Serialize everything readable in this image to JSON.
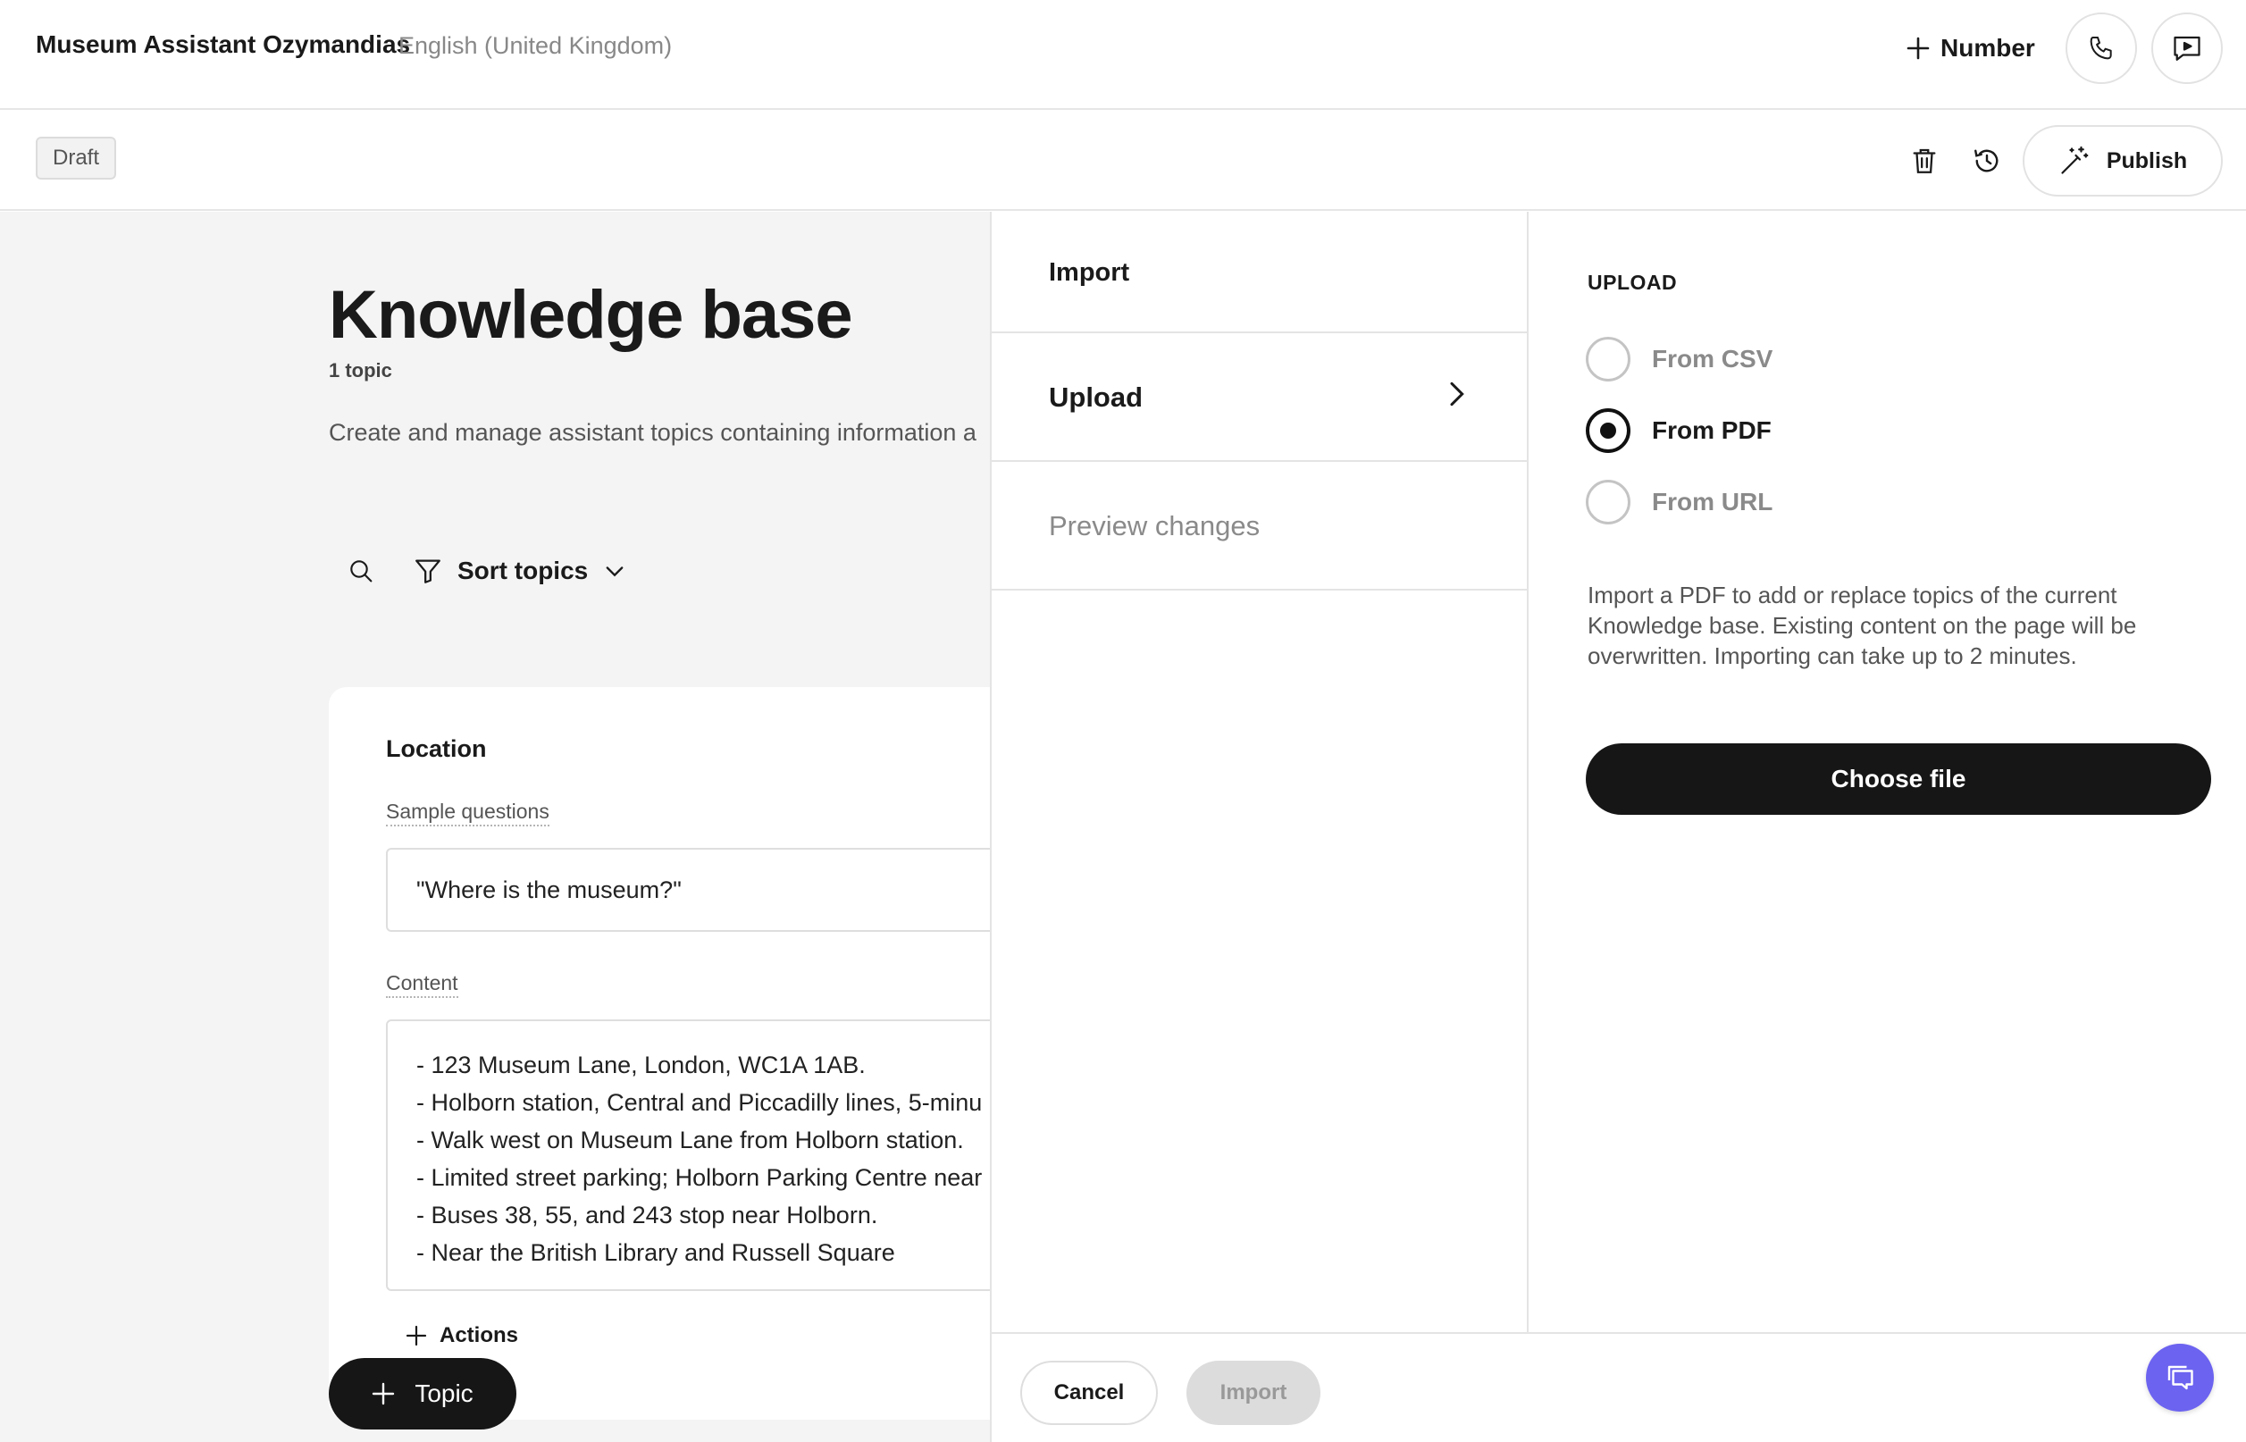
{
  "header": {
    "app_title": "Museum Assistant Ozymandias",
    "language": "English (United Kingdom)",
    "number_button": "Number",
    "phone_icon": "phone-icon",
    "preview_icon": "chat-play-icon"
  },
  "toolbar": {
    "status_badge": "Draft",
    "delete_icon": "trash-icon",
    "history_icon": "history-icon",
    "publish_label": "Publish"
  },
  "knowledge_base": {
    "title": "Knowledge base",
    "topic_count": "1 topic",
    "description": "Create and manage assistant topics containing information a",
    "sort_label": "Sort topics"
  },
  "topic_card": {
    "title": "Location",
    "sample_questions_label": "Sample questions",
    "sample_question": "\"Where is the museum?\"",
    "content_label": "Content",
    "content_lines": [
      "- 123 Museum Lane, London, WC1A 1AB.",
      "- Holborn station, Central and Piccadilly lines, 5-minu",
      "- Walk west on Museum Lane from Holborn station.",
      "- Limited street parking; Holborn Parking Centre near",
      "- Buses 38, 55, and 243 stop near Holborn.",
      "- Near the British Library and Russell Square"
    ],
    "actions_label": "Actions"
  },
  "add_topic_label": "Topic",
  "import_panel": {
    "steps": {
      "import": "Import",
      "upload": "Upload",
      "preview": "Preview changes"
    },
    "upload_heading": "UPLOAD",
    "options": [
      {
        "label": "From CSV",
        "selected": false
      },
      {
        "label": "From PDF",
        "selected": true
      },
      {
        "label": "From URL",
        "selected": false
      }
    ],
    "description": "Import a PDF to add or replace topics of the current Knowledge base. Existing content on the page will be overwritten. Importing can take up to 2 minutes.",
    "choose_file_label": "Choose file",
    "cancel_label": "Cancel",
    "import_label": "Import"
  },
  "colors": {
    "accent_chat": "#6c63f0",
    "primary_button": "#161616",
    "disabled_button": "#dcdcdc"
  }
}
